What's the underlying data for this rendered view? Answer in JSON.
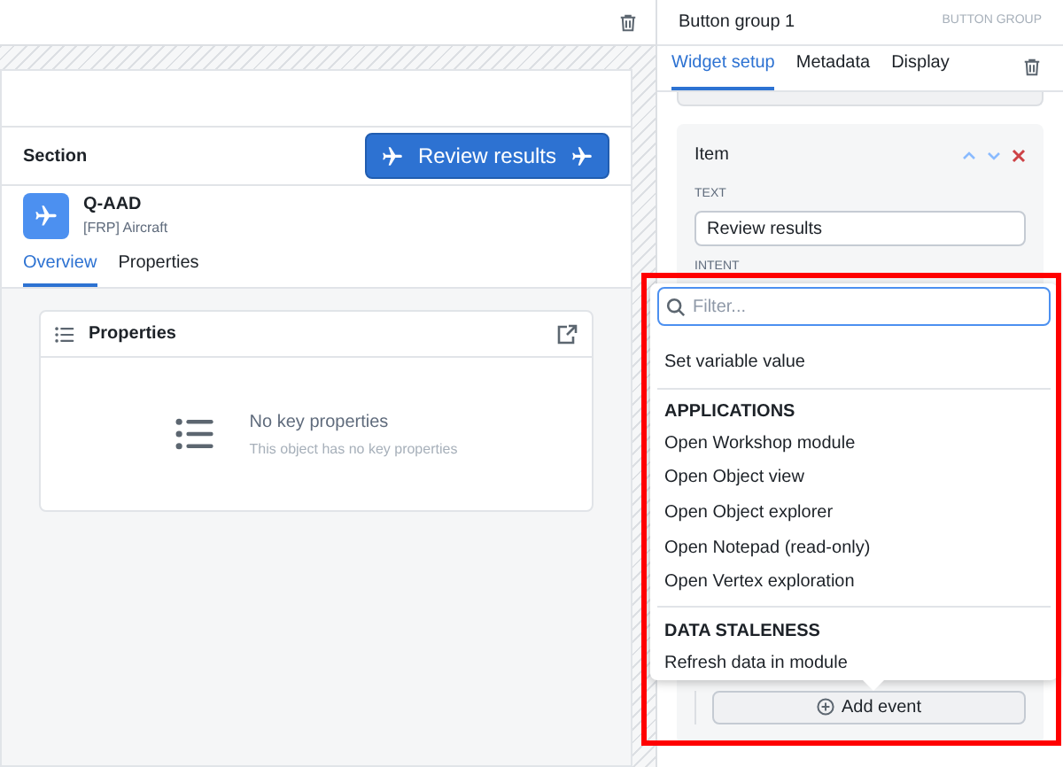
{
  "section": {
    "title": "Section",
    "button": {
      "label": "Review results"
    }
  },
  "object": {
    "name": "Q-AAD",
    "type": "[FRP] Aircraft"
  },
  "object_tabs": [
    {
      "label": "Overview",
      "selected": true
    },
    {
      "label": "Properties",
      "selected": false
    }
  ],
  "properties_card": {
    "title": "Properties",
    "empty_title": "No key properties",
    "empty_text": "This object has no key properties"
  },
  "panel": {
    "title": "Button group 1",
    "type": "BUTTON GROUP",
    "tabs": [
      {
        "label": "Widget setup",
        "selected": true
      },
      {
        "label": "Metadata",
        "selected": false
      },
      {
        "label": "Display",
        "selected": false
      }
    ],
    "item": {
      "title": "Item",
      "text_label": "TEXT",
      "text_value": "Review results",
      "intent_label": "INTENT"
    },
    "add_event": "Add event"
  },
  "dropdown": {
    "placeholder": "Filter...",
    "entries": [
      {
        "kind": "gap"
      },
      {
        "kind": "item",
        "label": "Set variable value"
      },
      {
        "kind": "header",
        "label": "APPLICATIONS"
      },
      {
        "kind": "item",
        "label": "Open Workshop module"
      },
      {
        "kind": "item",
        "label": "Open Object view"
      },
      {
        "kind": "item",
        "label": "Open Object explorer"
      },
      {
        "kind": "item",
        "label": "Open Notepad (read-only)"
      },
      {
        "kind": "item",
        "label": "Open Vertex exploration"
      },
      {
        "kind": "header",
        "label": "DATA STALENESS"
      },
      {
        "kind": "item",
        "label": "Refresh data in module"
      }
    ]
  }
}
